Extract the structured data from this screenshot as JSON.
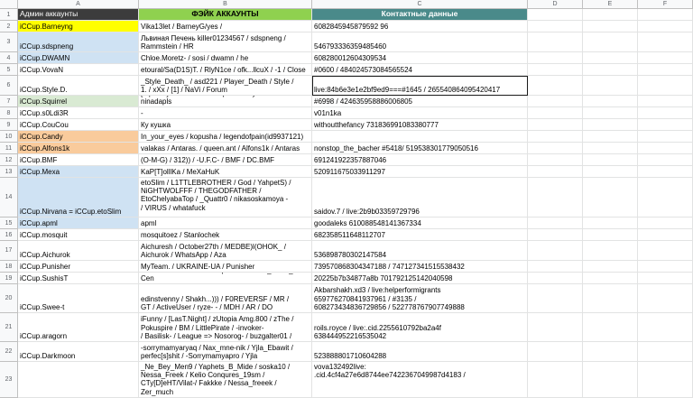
{
  "columns": [
    "A",
    "B",
    "C",
    "D",
    "E",
    "F"
  ],
  "colors": {
    "header_a": "#3c3c3c",
    "header_b": "#8fd14f",
    "header_c": "#4a8a8a",
    "yellow": "#ffff00",
    "light_blue": "#cfe2f3",
    "light_orange": "#f9cb9c",
    "light_green": "#d9ead3"
  },
  "rows": [
    {
      "num": "1",
      "a": "Админ аккаунты",
      "b": "ФЭЙК АККАУНТЫ",
      "c": "Контактные данные"
    },
    {
      "num": "2",
      "a": "iCCup.Barneyng",
      "b": "Vika13let / BarneyG/yes /",
      "c": "6082845945879592 96"
    },
    {
      "num": "3",
      "a": "iCCup.sdspneng",
      "b": "Львиная Печень killer01234567 / sdspneng /\nRammstein / HR",
      "c": "546793336359485460"
    },
    {
      "num": "4",
      "a": "iCCup.DWAMN",
      "b": "Chloe.Moretz- / sosi / dwamn / he",
      "c": "608280012604309534"
    },
    {
      "num": "5",
      "a": "iCCup.VovaN",
      "b": "etoural/Sa(D1S)T. / RlyN1ce / ofk...llcuX / -1 / Close",
      "c": "#0600 / 484024573084565524"
    },
    {
      "num": "6",
      "a": "iCCup.Style.D.",
      "b": "_Style_Death_ / asd221 / Player_Death / Style /\n1. / xXx / [1] / NaVi / Forum",
      "c": "live:84b6e3e1e2bf9ed9===#1645 / 265540864095420417"
    },
    {
      "num": "7",
      "a": "iCCup.Squirrel",
      "b": "[squirrel] / cadaveria HeOpuHaKucy / Alena /  ninadapls",
      "c": "#6998 / 424635958886006805"
    },
    {
      "num": "8",
      "a": "iCCup.s0Ldi3R",
      "b": "-",
      "c": "v01n1ka"
    },
    {
      "num": "9",
      "a": "iCCup.CouCou",
      "b": "Ку кушка",
      "c": "withoutthefancy   731836991083380777"
    },
    {
      "num": "10",
      "a": "iCCup.Candy",
      "b": "In_your_eyes / kopusha / legendofpain(id9937121)",
      "c": ""
    },
    {
      "num": "11",
      "a": "iCCup.Alfons1k",
      "b": "valakas / Antaras. / queen.ant / Alfons1k / Antaras",
      "c": "nonstop_the_bacher   #5418/ 519538301779050516"
    },
    {
      "num": "12",
      "a": "iCCup.BMF",
      "b": "(O-M-G) / 312)) / -U.F.C- / BMF / DC.BMF",
      "c": "691241922357887046"
    },
    {
      "num": "13",
      "a": "iCCup.Mexa",
      "b": "KaP[T]olllKa / MeXaHuK",
      "c": "520911675033911297"
    },
    {
      "num": "14",
      "a": "iCCup.Nirvana = iCCup.etoSlim",
      "b": "etoSlim / L1TTLEBROTHER /  God / YahpetS) /\nNiGHTWOLFFF /  THEGODFATHER /\nEtoChelyabaTop / _Quattr0 / nikasoskamoya -\n/ VIRUS / whatafuck",
      "c": "saidov.7 / live:2b9b03359729796"
    },
    {
      "num": "15",
      "a": "iCCup.apml",
      "b": "apml",
      "c": "goodaleks         610088548141367334"
    },
    {
      "num": "16",
      "a": "iCCup.mosquit",
      "b": "mosquitoez / Stanlochek",
      "c": "682358511648112707"
    },
    {
      "num": "17",
      "a": "iCCup.Aichurok",
      "b": "Aichuresh / October27th / MEDBE)l(OHOK_ /\n Aichurok / WhatsApp / Aza",
      "c": "536898780302147584"
    },
    {
      "num": "18",
      "a": "iCCup.Punisher",
      "b": "MyTeam. / UKRAINE-UA / Punisher",
      "c": "739570868304347188 / 747127341515538432"
    },
    {
      "num": "19",
      "a": "iCCup.SushisT",
      "b": "IOLSFKHENCORE / Gospodinaz /LoLo_PePe_96 / Cen",
      "c": "20225b7b34877a8b   701792125142040598"
    },
    {
      "num": "20",
      "a": "iCCup.Swee-t",
      "b": "edinstvenny / Shakh...))) /  F0REVERSF /  MR /\n GT / ActiveUser  / ryze- - / MDH / AR / DO",
      "c": "Akbarshakh.xd3 / live:helperformigrants\n659776270841937961 / #3135 /\n608273434836729856 / 522778767907749888"
    },
    {
      "num": "21",
      "a": "iCCup.aragorn",
      "b": "iFunny / [LasT.Night] / zUtopia Amg.800 / zThe /\n Pokuspire / BM / LittlePirate / -invoker-\n/ Basilisk- / League => Nosorog- / buzgalter01 /",
      "c": "roils.royce / live:.cid.2255610792ba2a4f\n 638444952216535042"
    },
    {
      "num": "22",
      "a": "iCCup.Darkmoon",
      "b": "-sorrymamyaryaq / Nax_mne-nik / Yjla_Ebawit /\nperfec[s]shit / -Sorrymamyapro / Yjla",
      "c": "523888801710604288"
    },
    {
      "num": "23",
      "a": "",
      "b": "_Ne_Bey_Men9 / Yaphets_B_Mide / soska10 /\nNessa_Freek / Kelio Conqures_19sm /\nCTy[D]eHT/Vilat-/ Fakkke  / Nessa_freeek /\nZer_much",
      "c": "vova132492live:\n.cid.4cf4a27e6d8744ee7422367049987d4183 /"
    }
  ]
}
